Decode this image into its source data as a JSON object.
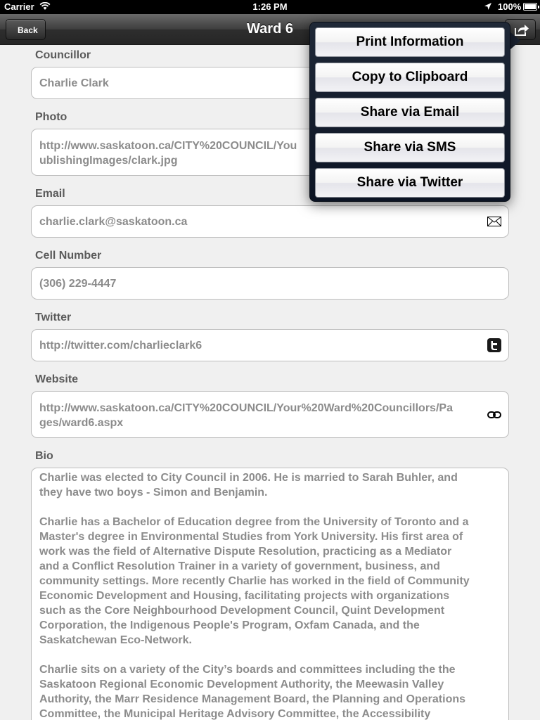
{
  "status_bar": {
    "carrier": "Carrier",
    "time": "1:26 PM",
    "battery": "100%"
  },
  "nav": {
    "back_label": "Back",
    "title": "Ward 6"
  },
  "form": {
    "councillor": {
      "label": "Councillor",
      "value": "Charlie Clark"
    },
    "photo": {
      "label": "Photo",
      "value": "http://www.saskatoon.ca/CITY%20COUNCIL/Your%20Ward%20Councillors/PublishingImages/clark.jpg",
      "line1": "http://www.saskatoon.ca/CITY%20COUNCIL/You",
      "line2": "ublishingImages/clark.jpg"
    },
    "email": {
      "label": "Email",
      "value": "charlie.clark@saskatoon.ca",
      "icon": "envelope-icon"
    },
    "cell": {
      "label": "Cell Number",
      "value": "(306) 229-4447"
    },
    "twitter": {
      "label": "Twitter",
      "value": "http://twitter.com/charlieclark6",
      "icon": "twitter-icon"
    },
    "website": {
      "label": "Website",
      "line1": "http://www.saskatoon.ca/CITY%20COUNCIL/Your%20Ward%20Councillors/Pa",
      "line2": "ges/ward6.aspx",
      "icon": "link-icon"
    },
    "bio": {
      "label": "Bio",
      "p1_l1": "Charlie was elected to City Council in 2006. He is married to Sarah Buhler, and",
      "p1_l2": "they have two boys - Simon and Benjamin.",
      "p2_l1": "Charlie has a Bachelor of Education degree from the University of Toronto and a",
      "p2_l2": "Master's degree in Environmental Studies from York University. His first area of",
      "p2_l3": "work was the field of Alternative Dispute Resolution, practicing as a Mediator",
      "p2_l4": "and a Conflict Resolution Trainer in a variety of government, business, and",
      "p2_l5": "community settings. More recently Charlie has worked in the field of Community",
      "p2_l6": "Economic Development and Housing, facilitating projects with organizations",
      "p2_l7": "such as the Core Neighbourhood Development Council, Quint Development",
      "p2_l8": "Corporation, the Indigenous People's Program, Oxfam Canada, and the",
      "p2_l9": "Saskatchewan Eco-Network.",
      "p3_l1": "Charlie sits on a variety of the City’s boards and committees including the the",
      "p3_l2": "Saskatoon Regional Economic Development Authority, the Meewasin Valley",
      "p3_l3": "Authority, the Marr Residence Management Board, the Planning and Operations",
      "p3_l4": "Committee, the Municipal Heritage Advisory Committee, the Accessibility"
    }
  },
  "popover": {
    "items": [
      "Print Information",
      "Copy to Clipboard",
      "Share via Email",
      "Share via SMS",
      "Share via Twitter"
    ]
  }
}
